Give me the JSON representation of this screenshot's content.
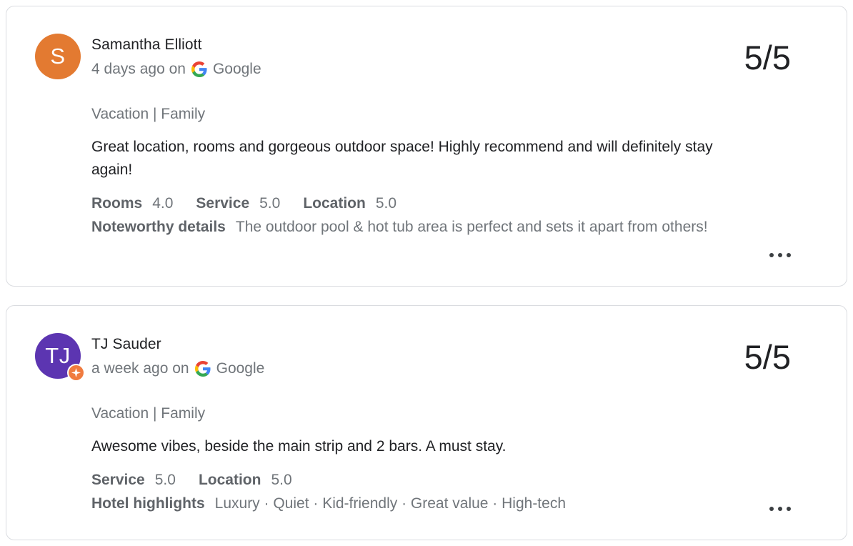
{
  "reviews": [
    {
      "avatar_initial": "S",
      "avatar_color": "#e37a31",
      "name": "Samantha Elliott",
      "time_prefix": "4 days ago on",
      "source": "Google",
      "score": "5/5",
      "trip_type": "Vacation | Family",
      "text": "Great location, rooms and gorgeous outdoor space! Highly recommend and will definitely stay again!",
      "ratings": [
        {
          "label": "Rooms",
          "value": "4.0"
        },
        {
          "label": "Service",
          "value": "5.0"
        },
        {
          "label": "Location",
          "value": "5.0"
        }
      ],
      "detail_label": "Noteworthy details",
      "detail_value": "The outdoor pool & hot tub area is perfect and sets it apart from others!"
    },
    {
      "avatar_initial": "TJ",
      "avatar_color": "#5c35b1",
      "badge_icon": "local-guide-star-icon",
      "badge_color": "#f07b3f",
      "name": "TJ Sauder",
      "time_prefix": "a week ago on",
      "source": "Google",
      "score": "5/5",
      "trip_type": "Vacation | Family",
      "text": "Awesome vibes, beside the main strip and 2 bars. A must stay.",
      "ratings": [
        {
          "label": "Service",
          "value": "5.0"
        },
        {
          "label": "Location",
          "value": "5.0"
        }
      ],
      "detail_label": "Hotel highlights",
      "detail_value": "Luxury · Quiet · Kid-friendly · Great value · High-tech"
    }
  ]
}
